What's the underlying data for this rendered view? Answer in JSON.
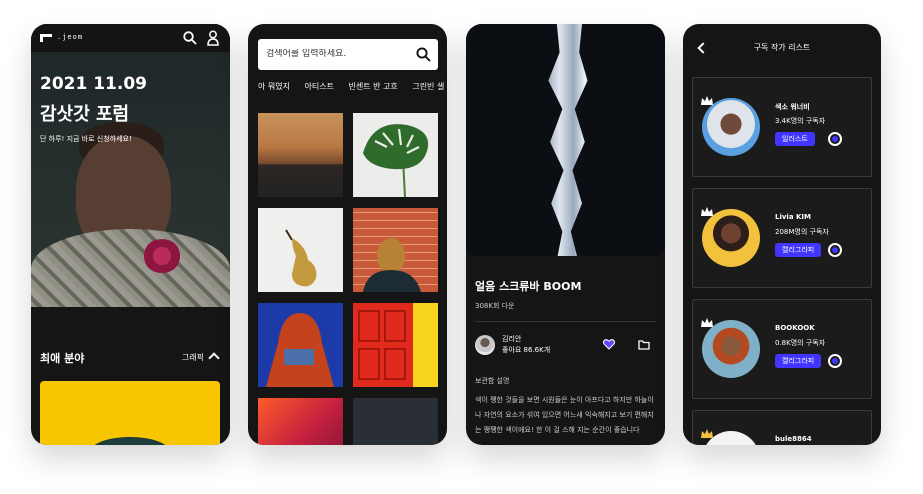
{
  "phone1": {
    "logo_text": ".jeom",
    "hero_date": "2021 11.09",
    "hero_title": "감삿갓 포럼",
    "hero_subtitle": "단 하루! 지금 바로 신청하세요!",
    "section_title": "최애 분야",
    "section_filter": "그래픽",
    "icons": [
      "logo-icon",
      "search-icon",
      "user-icon",
      "chevron-up-icon"
    ]
  },
  "phone2": {
    "search_placeholder": "검색어를 입력하세요.",
    "tabs": [
      "아 뭐였지",
      "아티스트",
      "빈센트 반 고흐",
      "그린빈 샐"
    ],
    "icons": [
      "search-icon"
    ]
  },
  "phone3": {
    "title": "얼음 스크류바 BOOM",
    "views": "308K회 다운",
    "artist_name": "김리안",
    "artist_likes": "좋아요 86.6K개",
    "description_label": "보관함 설명",
    "description": "색이 쨍한 것들을 보면 시원들은 눈이 아프다고 하지만 하늘이나 자연의 요소가 섞여 있으면 어느새 익숙해지고 보기 편해지는 쨍쨍한 색이에요! 한 이 걸 스해 지는 순간이 좋습니다",
    "icons": [
      "heart-icon",
      "folder-icon"
    ]
  },
  "phone4": {
    "title": "구독 작가 리스트",
    "artists": [
      {
        "name": "색소 워너비",
        "subscribers": "3.4K명의 구독자",
        "button": "일러스트"
      },
      {
        "name": "Livia KIM",
        "subscribers": "208M명의 구독자",
        "button": "캘리그라피"
      },
      {
        "name": "BOOKOOK",
        "subscribers": "0.8K명의 구독자",
        "button": "캘리그라피"
      },
      {
        "name": "bule8864",
        "subscribers": "",
        "button": ""
      }
    ],
    "accent_color": "#4135ff",
    "icons": [
      "back-chevron-icon",
      "crown-icon",
      "radio-icon"
    ]
  }
}
